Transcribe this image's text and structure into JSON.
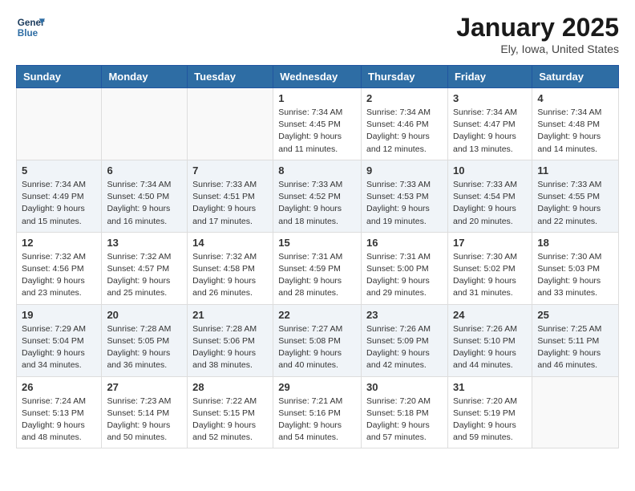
{
  "header": {
    "logo_line1": "General",
    "logo_line2": "Blue",
    "month": "January 2025",
    "location": "Ely, Iowa, United States"
  },
  "weekdays": [
    "Sunday",
    "Monday",
    "Tuesday",
    "Wednesday",
    "Thursday",
    "Friday",
    "Saturday"
  ],
  "weeks": [
    [
      {
        "day": "",
        "info": ""
      },
      {
        "day": "",
        "info": ""
      },
      {
        "day": "",
        "info": ""
      },
      {
        "day": "1",
        "info": "Sunrise: 7:34 AM\nSunset: 4:45 PM\nDaylight: 9 hours\nand 11 minutes."
      },
      {
        "day": "2",
        "info": "Sunrise: 7:34 AM\nSunset: 4:46 PM\nDaylight: 9 hours\nand 12 minutes."
      },
      {
        "day": "3",
        "info": "Sunrise: 7:34 AM\nSunset: 4:47 PM\nDaylight: 9 hours\nand 13 minutes."
      },
      {
        "day": "4",
        "info": "Sunrise: 7:34 AM\nSunset: 4:48 PM\nDaylight: 9 hours\nand 14 minutes."
      }
    ],
    [
      {
        "day": "5",
        "info": "Sunrise: 7:34 AM\nSunset: 4:49 PM\nDaylight: 9 hours\nand 15 minutes."
      },
      {
        "day": "6",
        "info": "Sunrise: 7:34 AM\nSunset: 4:50 PM\nDaylight: 9 hours\nand 16 minutes."
      },
      {
        "day": "7",
        "info": "Sunrise: 7:33 AM\nSunset: 4:51 PM\nDaylight: 9 hours\nand 17 minutes."
      },
      {
        "day": "8",
        "info": "Sunrise: 7:33 AM\nSunset: 4:52 PM\nDaylight: 9 hours\nand 18 minutes."
      },
      {
        "day": "9",
        "info": "Sunrise: 7:33 AM\nSunset: 4:53 PM\nDaylight: 9 hours\nand 19 minutes."
      },
      {
        "day": "10",
        "info": "Sunrise: 7:33 AM\nSunset: 4:54 PM\nDaylight: 9 hours\nand 20 minutes."
      },
      {
        "day": "11",
        "info": "Sunrise: 7:33 AM\nSunset: 4:55 PM\nDaylight: 9 hours\nand 22 minutes."
      }
    ],
    [
      {
        "day": "12",
        "info": "Sunrise: 7:32 AM\nSunset: 4:56 PM\nDaylight: 9 hours\nand 23 minutes."
      },
      {
        "day": "13",
        "info": "Sunrise: 7:32 AM\nSunset: 4:57 PM\nDaylight: 9 hours\nand 25 minutes."
      },
      {
        "day": "14",
        "info": "Sunrise: 7:32 AM\nSunset: 4:58 PM\nDaylight: 9 hours\nand 26 minutes."
      },
      {
        "day": "15",
        "info": "Sunrise: 7:31 AM\nSunset: 4:59 PM\nDaylight: 9 hours\nand 28 minutes."
      },
      {
        "day": "16",
        "info": "Sunrise: 7:31 AM\nSunset: 5:00 PM\nDaylight: 9 hours\nand 29 minutes."
      },
      {
        "day": "17",
        "info": "Sunrise: 7:30 AM\nSunset: 5:02 PM\nDaylight: 9 hours\nand 31 minutes."
      },
      {
        "day": "18",
        "info": "Sunrise: 7:30 AM\nSunset: 5:03 PM\nDaylight: 9 hours\nand 33 minutes."
      }
    ],
    [
      {
        "day": "19",
        "info": "Sunrise: 7:29 AM\nSunset: 5:04 PM\nDaylight: 9 hours\nand 34 minutes."
      },
      {
        "day": "20",
        "info": "Sunrise: 7:28 AM\nSunset: 5:05 PM\nDaylight: 9 hours\nand 36 minutes."
      },
      {
        "day": "21",
        "info": "Sunrise: 7:28 AM\nSunset: 5:06 PM\nDaylight: 9 hours\nand 38 minutes."
      },
      {
        "day": "22",
        "info": "Sunrise: 7:27 AM\nSunset: 5:08 PM\nDaylight: 9 hours\nand 40 minutes."
      },
      {
        "day": "23",
        "info": "Sunrise: 7:26 AM\nSunset: 5:09 PM\nDaylight: 9 hours\nand 42 minutes."
      },
      {
        "day": "24",
        "info": "Sunrise: 7:26 AM\nSunset: 5:10 PM\nDaylight: 9 hours\nand 44 minutes."
      },
      {
        "day": "25",
        "info": "Sunrise: 7:25 AM\nSunset: 5:11 PM\nDaylight: 9 hours\nand 46 minutes."
      }
    ],
    [
      {
        "day": "26",
        "info": "Sunrise: 7:24 AM\nSunset: 5:13 PM\nDaylight: 9 hours\nand 48 minutes."
      },
      {
        "day": "27",
        "info": "Sunrise: 7:23 AM\nSunset: 5:14 PM\nDaylight: 9 hours\nand 50 minutes."
      },
      {
        "day": "28",
        "info": "Sunrise: 7:22 AM\nSunset: 5:15 PM\nDaylight: 9 hours\nand 52 minutes."
      },
      {
        "day": "29",
        "info": "Sunrise: 7:21 AM\nSunset: 5:16 PM\nDaylight: 9 hours\nand 54 minutes."
      },
      {
        "day": "30",
        "info": "Sunrise: 7:20 AM\nSunset: 5:18 PM\nDaylight: 9 hours\nand 57 minutes."
      },
      {
        "day": "31",
        "info": "Sunrise: 7:20 AM\nSunset: 5:19 PM\nDaylight: 9 hours\nand 59 minutes."
      },
      {
        "day": "",
        "info": ""
      }
    ]
  ]
}
